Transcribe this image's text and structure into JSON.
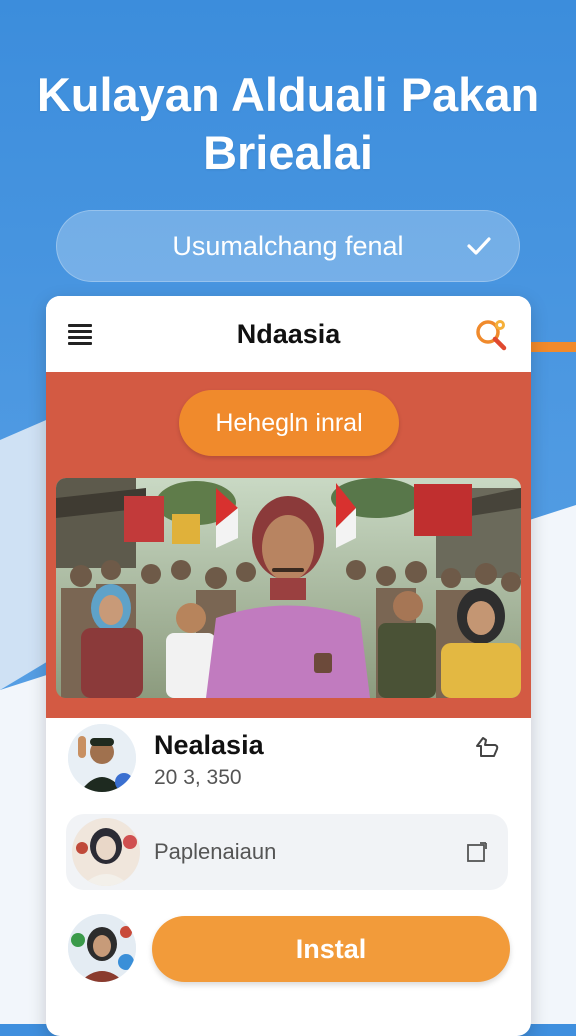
{
  "hero": {
    "title_line1": "Kulayan Alduali Pakan",
    "title_line2": "Briealai"
  },
  "selector": {
    "value": "Usumalchang fenal",
    "icon": "check-icon"
  },
  "card": {
    "topbar": {
      "title": "Ndaasia",
      "menu_icon": "hamburger-menu-icon",
      "search_icon": "search-icon"
    },
    "banner_button": "Hehegln inral",
    "app": {
      "name": "Nealasia",
      "count": "20 3, 350",
      "like_icon": "thumbs-up-icon"
    },
    "field": {
      "placeholder": "Paplenaiaun",
      "icon": "expand-icon"
    },
    "install_label": "Instal"
  },
  "colors": {
    "background": "#3c8ddc",
    "banner": "#d35a43",
    "accent_orange": "#f08a2c",
    "install_orange": "#f29b3a"
  }
}
